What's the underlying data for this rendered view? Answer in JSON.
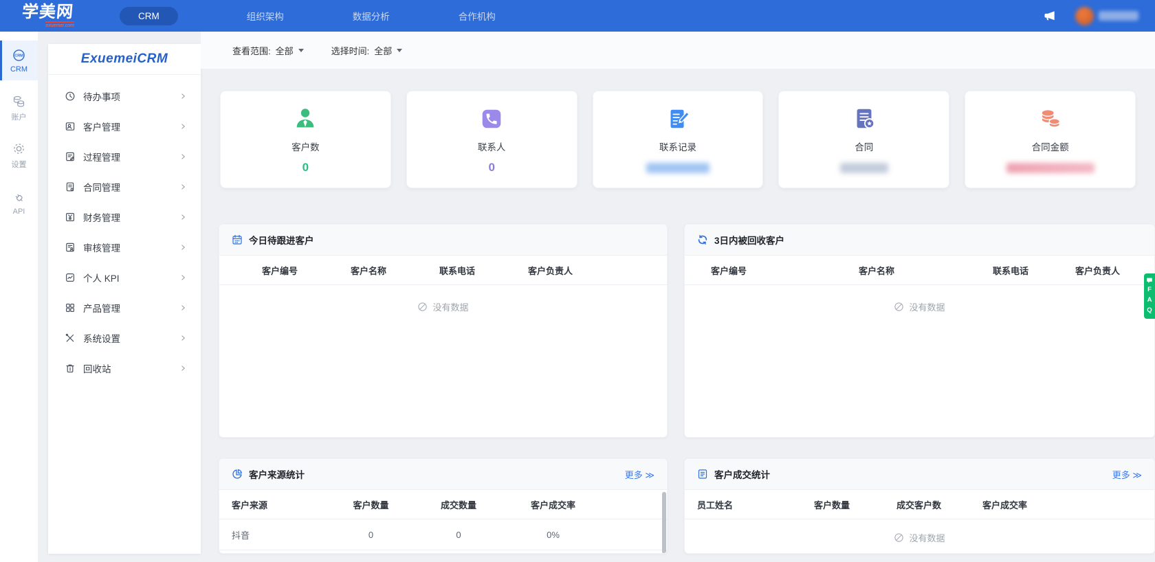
{
  "navbar": {
    "logo_title": "学美网",
    "logo_subtitle": "exuemei.com",
    "items": [
      {
        "label": "CRM",
        "active": true
      },
      {
        "label": "组织架构",
        "active": false
      },
      {
        "label": "数据分析",
        "active": false
      },
      {
        "label": "合作机构",
        "active": false
      }
    ]
  },
  "rail": {
    "items": [
      {
        "label": "CRM",
        "active": true
      },
      {
        "label": "账户",
        "active": false
      },
      {
        "label": "设置",
        "active": false
      },
      {
        "label": "API",
        "active": false
      }
    ]
  },
  "sidebar": {
    "logo": "ExuemeiCRM",
    "items": [
      {
        "label": "待办事项"
      },
      {
        "label": "客户管理"
      },
      {
        "label": "过程管理"
      },
      {
        "label": "合同管理"
      },
      {
        "label": "财务管理"
      },
      {
        "label": "审核管理"
      },
      {
        "label": "个人 KPI"
      },
      {
        "label": "产品管理"
      },
      {
        "label": "系统设置"
      },
      {
        "label": "回收站"
      }
    ]
  },
  "filters": {
    "scope_label": "查看范围:",
    "scope_value": "全部",
    "time_label": "选择时间:",
    "time_value": "全部"
  },
  "stats": [
    {
      "label": "客户数",
      "value": "0",
      "color": "#2fbd80",
      "icon": "customer-user"
    },
    {
      "label": "联系人",
      "value": "0",
      "color": "#8b7de0",
      "icon": "phone"
    },
    {
      "label": "联系记录",
      "value": "",
      "redacted": true,
      "icon": "document-pencil"
    },
    {
      "label": "合同",
      "value": "",
      "redacted": true,
      "icon": "document-star"
    },
    {
      "label": "合同金额",
      "value": "",
      "redacted": true,
      "icon": "coins"
    }
  ],
  "panels": {
    "follow": {
      "title": "今日待跟进客户",
      "icon": "calendar",
      "columns": [
        "客户编号",
        "客户名称",
        "联系电话",
        "客户负责人"
      ],
      "empty_text": "没有数据"
    },
    "recycled": {
      "title": "3日内被回收客户",
      "icon": "recycle",
      "columns": [
        "客户编号",
        "客户名称",
        "联系电话",
        "客户负责人"
      ],
      "empty_text": "没有数据"
    },
    "source": {
      "title": "客户来源统计",
      "icon": "pie-chart",
      "more_label": "更多 ≫",
      "columns": [
        "客户来源",
        "客户数量",
        "成交数量",
        "客户成交率"
      ],
      "rows": [
        {
          "c0": "抖音",
          "c1": "0",
          "c2": "0",
          "c3": "0%"
        }
      ]
    },
    "deal": {
      "title": "客户成交统计",
      "icon": "report-list",
      "more_label": "更多 ≫",
      "columns": [
        "员工姓名",
        "客户数量",
        "成交客户数",
        "客户成交率"
      ],
      "empty_text": "没有数据"
    }
  },
  "faq": {
    "l0": "F",
    "l1": "A",
    "l2": "Q"
  },
  "colors": {
    "navbar": "#2d6cd9",
    "accent": "#2f6fdb",
    "green": "#2fbd80",
    "purple": "#8b7de0",
    "blue": "#3f8df2",
    "indigo": "#6673c0",
    "salmon": "#f28a74",
    "faq_green": "#0cbd70"
  }
}
